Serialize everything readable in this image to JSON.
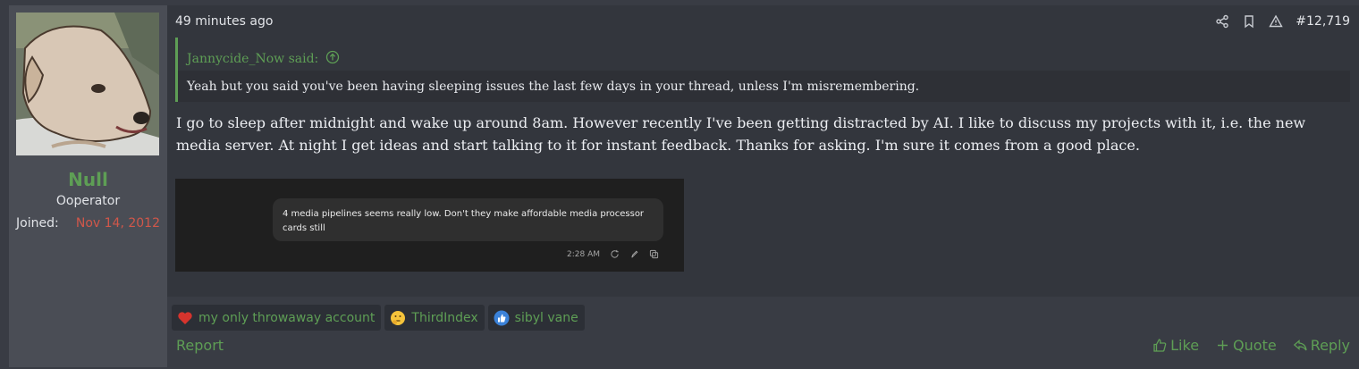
{
  "user": {
    "name": "Null",
    "title": "Ooperator",
    "joined_label": "Joined:",
    "joined_value": "Nov 14, 2012"
  },
  "post": {
    "timestamp": "49 minutes ago",
    "number": "#12,719",
    "icons": [
      "share-icon",
      "bookmark-icon",
      "report-warning-icon"
    ]
  },
  "quote": {
    "author_said": "Jannycide_Now said:",
    "text": "Yeah but you said you've been having sleeping issues the last few days in your thread, unless I'm misremembering."
  },
  "message": {
    "text": "I go to sleep after midnight and wake up around 8am. However recently I've been getting distracted by AI. I like to discuss my projects with it, i.e. the new media server. At night I get ideas and start talking to it for instant feedback. Thanks for asking. I'm sure it comes from a good place."
  },
  "attachment": {
    "bubble_text": "4 media pipelines seems really low. Don't they make affordable media processor cards still",
    "time": "2:28 AM"
  },
  "reactions": [
    {
      "icon": "heart-icon",
      "name": "my only throwaway account"
    },
    {
      "icon": "thinking-emoji-icon",
      "name": "ThirdIndex"
    },
    {
      "icon": "thumbs-up-icon",
      "name": "sibyl vane"
    }
  ],
  "footer": {
    "report": "Report",
    "like": "Like",
    "quote": "Quote",
    "reply": "Reply"
  },
  "colors": {
    "accent_green": "#5e9e55",
    "joined_red": "#d1574a",
    "background": "#393c44"
  }
}
